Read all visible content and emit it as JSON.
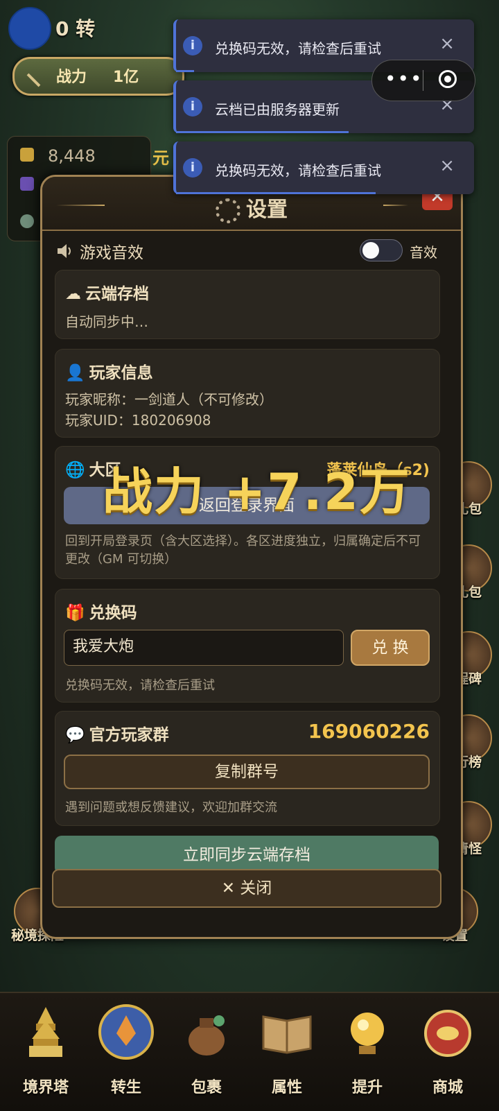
{
  "hud": {
    "rebirth": "0 转",
    "power_label": "战力",
    "power_value": "1亿",
    "gold": "8,448",
    "yuan": "元"
  },
  "side_buttons": {
    "gift1": "礼包",
    "gift2": "礼包",
    "monument": "程碑",
    "ranking": "行榜",
    "clear": "清怪",
    "settings": "设置",
    "secret": "秘境探险"
  },
  "nav": [
    {
      "label": "境界塔",
      "icon": "pagoda-icon"
    },
    {
      "label": "转生",
      "icon": "phoenix-icon"
    },
    {
      "label": "包裹",
      "icon": "bag-icon"
    },
    {
      "label": "属性",
      "icon": "book-icon"
    },
    {
      "label": "提升",
      "icon": "orb-icon"
    },
    {
      "label": "商城",
      "icon": "treasure-icon"
    }
  ],
  "dialog": {
    "title": "设置",
    "close_x": "✕",
    "sound": {
      "label": "游戏音效",
      "toggle_label": "音效",
      "enabled": false
    },
    "cloud": {
      "title": "云端存档",
      "status": "自动同步中…"
    },
    "player": {
      "title": "玩家信息",
      "nickname": "玩家昵称：一剑道人（不可修改）",
      "uid": "玩家UID：180206908"
    },
    "region": {
      "title": "大区",
      "server": "蓬莱仙岛（s2)",
      "button": "返回登录界面",
      "note": "回到开局登录页（含大区选择）。各区进度独立，归属确定后不可更改（GM 可切换）"
    },
    "redeem": {
      "title": "兑换码",
      "input_value": "我爱大炮",
      "button": "兑 换",
      "status": "兑换码无效，请检查后重试"
    },
    "group": {
      "title": "官方玩家群",
      "number": "169060226",
      "button": "复制群号",
      "note": "遇到问题或想反馈建议，欢迎加群交流"
    },
    "sync_button": "立即同步云端存档",
    "close_button": "✕ 关闭"
  },
  "overlay": {
    "power_gain": "战力 +7.2万"
  },
  "toasts": [
    {
      "message": "兑换码无效，请检查后重试",
      "close": "×",
      "progress": 0.06
    },
    {
      "message": "云档已由服务器更新",
      "close": "×",
      "progress": 0.58
    },
    {
      "message": "兑换码无效，请检查后重试",
      "close": "×",
      "progress": 0.67
    }
  ],
  "capsule": {
    "more": "•••"
  }
}
